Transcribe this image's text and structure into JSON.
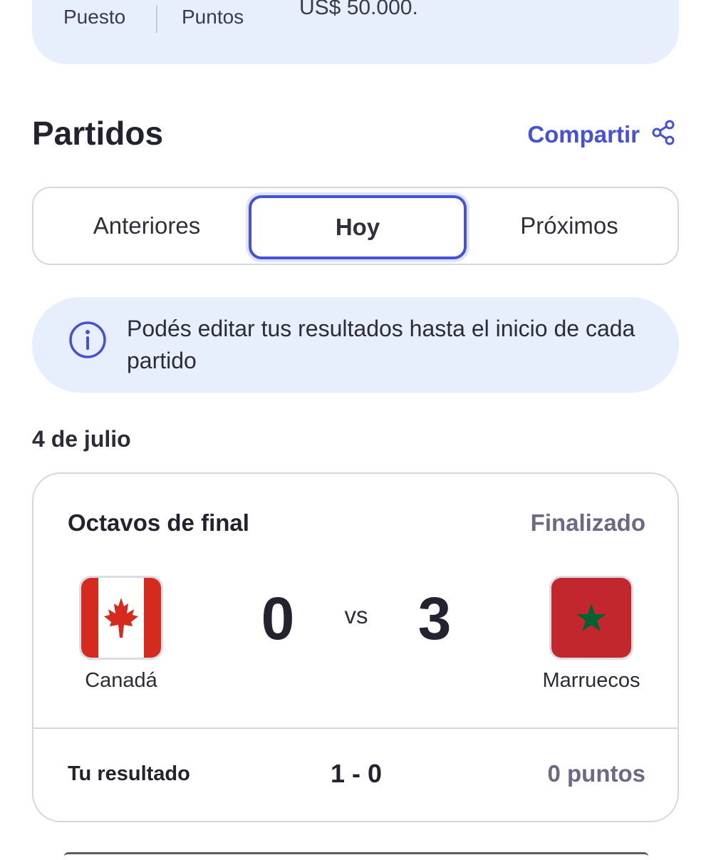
{
  "stats": {
    "position_label": "Puesto",
    "points_label": "Puntos",
    "prize": "US$ 50.000."
  },
  "section": {
    "title": "Partidos",
    "share_label": "Compartir",
    "share_icon": "share-icon"
  },
  "tabs": [
    {
      "label": "Anteriores",
      "selected": false
    },
    {
      "label": "Hoy",
      "selected": true
    },
    {
      "label": "Próximos",
      "selected": false
    }
  ],
  "info_banner": {
    "icon": "info-icon",
    "text": "Podés editar tus resultados hasta el inicio de cada partido"
  },
  "date_heading": "4 de julio",
  "match": {
    "stage": "Octavos de final",
    "status": "Finalizado",
    "home": {
      "name": "Canadá",
      "score": "0",
      "flag": "canada-flag"
    },
    "away": {
      "name": "Marruecos",
      "score": "3",
      "flag": "morocco-flag"
    },
    "vs": "vs",
    "prediction_label": "Tu resultado",
    "prediction": "1 - 0",
    "points": "0 puntos"
  },
  "colors": {
    "accent": "#4652d6",
    "banner_bg": "#e8effc",
    "muted": "#6a6a84"
  }
}
